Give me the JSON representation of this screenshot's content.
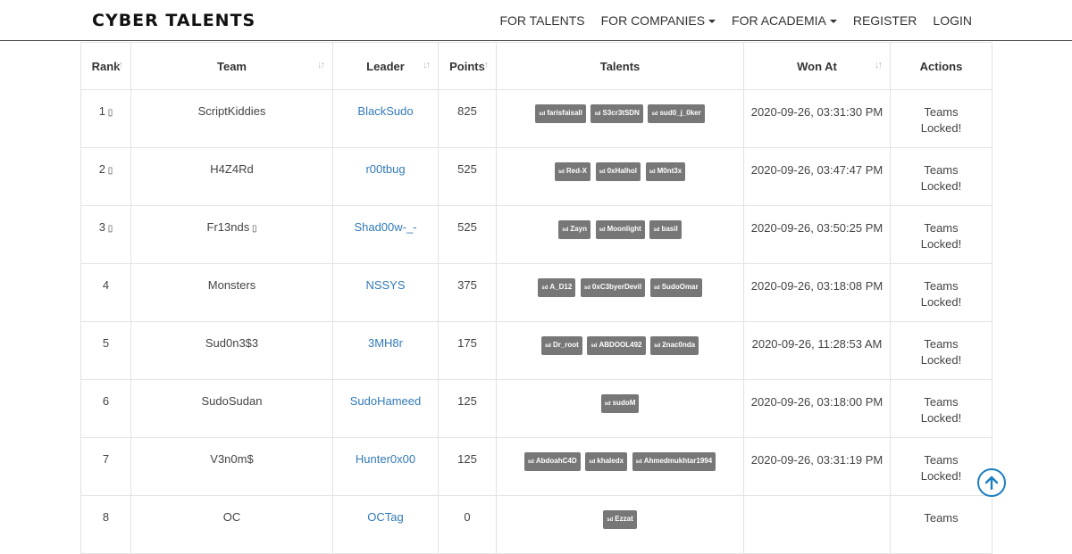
{
  "brand": "CYBER TALENTS",
  "nav": [
    {
      "label": "FOR TALENTS",
      "dropdown": false
    },
    {
      "label": "FOR COMPANIES",
      "dropdown": true
    },
    {
      "label": "FOR ACADEMIA",
      "dropdown": true
    },
    {
      "label": "REGISTER",
      "dropdown": false
    },
    {
      "label": "LOGIN",
      "dropdown": false
    }
  ],
  "columns": [
    "Rank",
    "Team",
    "Leader",
    "Points",
    "Talents",
    "Won At",
    "Actions"
  ],
  "rows": [
    {
      "rank": "1",
      "medal": true,
      "team": "ScriptKiddies",
      "team_icon": false,
      "leader": "BlackSudo",
      "points": "825",
      "talents": [
        "farisfaisall",
        "S3cr3tSDN",
        "sud0_j_0ker"
      ],
      "won": "2020-09-26, 03:31:30 PM",
      "action": "Teams Locked!"
    },
    {
      "rank": "2",
      "medal": true,
      "team": "H4Z4Rd",
      "team_icon": false,
      "leader": "r00tbug",
      "points": "525",
      "talents": [
        "Red-X",
        "0xHalhol",
        "M0nt3x"
      ],
      "won": "2020-09-26, 03:47:47 PM",
      "action": "Teams Locked!"
    },
    {
      "rank": "3",
      "medal": true,
      "team": "Fr13nds",
      "team_icon": true,
      "leader": "Shad00w-_-",
      "points": "525",
      "talents": [
        "Zayn",
        "Moonlight",
        "basil"
      ],
      "won": "2020-09-26, 03:50:25 PM",
      "action": "Teams Locked!"
    },
    {
      "rank": "4",
      "medal": false,
      "team": "Monsters",
      "team_icon": false,
      "leader": "NSSYS",
      "points": "375",
      "talents": [
        "A_D12",
        "0xC3byerDevil",
        "SudoOmar"
      ],
      "won": "2020-09-26, 03:18:08 PM",
      "action": "Teams Locked!"
    },
    {
      "rank": "5",
      "medal": false,
      "team": "Sud0n3$3",
      "team_icon": false,
      "leader": "3MH8r",
      "points": "175",
      "talents": [
        "Dr_root",
        "ABDOOL492",
        "2nac0nda"
      ],
      "won": "2020-09-26, 11:28:53 AM",
      "action": "Teams Locked!"
    },
    {
      "rank": "6",
      "medal": false,
      "team": "SudoSudan",
      "team_icon": false,
      "leader": "SudoHameed",
      "points": "125",
      "talents": [
        "sudoM"
      ],
      "won": "2020-09-26, 03:18:00 PM",
      "action": "Teams Locked!"
    },
    {
      "rank": "7",
      "medal": false,
      "team": "V3n0m$",
      "team_icon": false,
      "leader": "Hunter0x00",
      "points": "125",
      "talents": [
        "AbdoahC4D",
        "khaledx",
        "Ahmedmukhtar1994"
      ],
      "won": "2020-09-26, 03:31:19 PM",
      "action": "Teams Locked!"
    },
    {
      "rank": "8",
      "medal": false,
      "team": "OC",
      "team_icon": false,
      "leader": "OCTag",
      "points": "0",
      "talents": [
        "Ezzat"
      ],
      "won": "",
      "action": "Teams"
    }
  ],
  "badge_prefix": "sd",
  "icons": {
    "sort": "sort-icon",
    "medal": "medal-icon",
    "scroll_top": "arrow-up-icon"
  },
  "colors": {
    "link": "#337ab7",
    "badge": "#777777",
    "locked": "#8a6d3b",
    "scroll_btn": "#1d7fc1"
  }
}
